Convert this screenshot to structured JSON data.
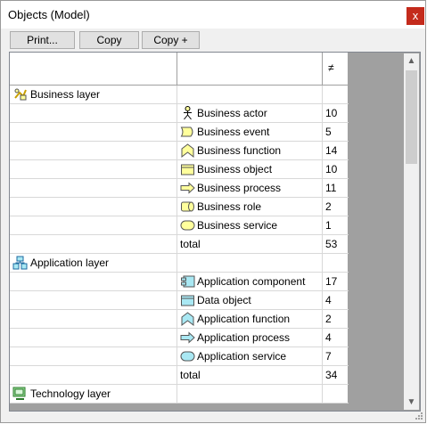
{
  "window": {
    "title": "Objects (Model)",
    "close_glyph": "x"
  },
  "toolbar": {
    "print_label": "Print...",
    "copy_label": "Copy",
    "copy_plus_label": "Copy +"
  },
  "table": {
    "count_header_icon": "sort-icon",
    "count_header_glyph": "≠",
    "rows": [
      {
        "kind": "layer",
        "layer": "Business layer",
        "icon": "business-layer-icon"
      },
      {
        "kind": "element",
        "element": "Business actor",
        "icon": "business-actor-icon",
        "count": "10"
      },
      {
        "kind": "element",
        "element": "Business event",
        "icon": "business-event-icon",
        "count": "5"
      },
      {
        "kind": "element",
        "element": "Business function",
        "icon": "business-function-icon",
        "count": "14"
      },
      {
        "kind": "element",
        "element": "Business object",
        "icon": "business-object-icon",
        "count": "10"
      },
      {
        "kind": "element",
        "element": "Business process",
        "icon": "business-process-icon",
        "count": "11"
      },
      {
        "kind": "element",
        "element": "Business role",
        "icon": "business-role-icon",
        "count": "2"
      },
      {
        "kind": "element",
        "element": "Business service",
        "icon": "business-service-icon",
        "count": "1"
      },
      {
        "kind": "total",
        "element": "total",
        "count": "53"
      },
      {
        "kind": "layer",
        "layer": "Application layer",
        "icon": "application-layer-icon"
      },
      {
        "kind": "element",
        "element": "Application component",
        "icon": "application-component-icon",
        "count": "17"
      },
      {
        "kind": "element",
        "element": "Data object",
        "icon": "data-object-icon",
        "count": "4"
      },
      {
        "kind": "element",
        "element": "Application function",
        "icon": "application-function-icon",
        "count": "2"
      },
      {
        "kind": "element",
        "element": "Application process",
        "icon": "application-process-icon",
        "count": "4"
      },
      {
        "kind": "element",
        "element": "Application service",
        "icon": "application-service-icon",
        "count": "7"
      },
      {
        "kind": "total",
        "element": "total",
        "count": "34"
      },
      {
        "kind": "layer",
        "layer": "Technology layer",
        "icon": "technology-layer-icon"
      }
    ]
  },
  "colors": {
    "business_fill": "#ffff9c",
    "application_fill": "#a9e8f3",
    "technology_fill": "#9ee39e",
    "close_red": "#c42b1c"
  }
}
